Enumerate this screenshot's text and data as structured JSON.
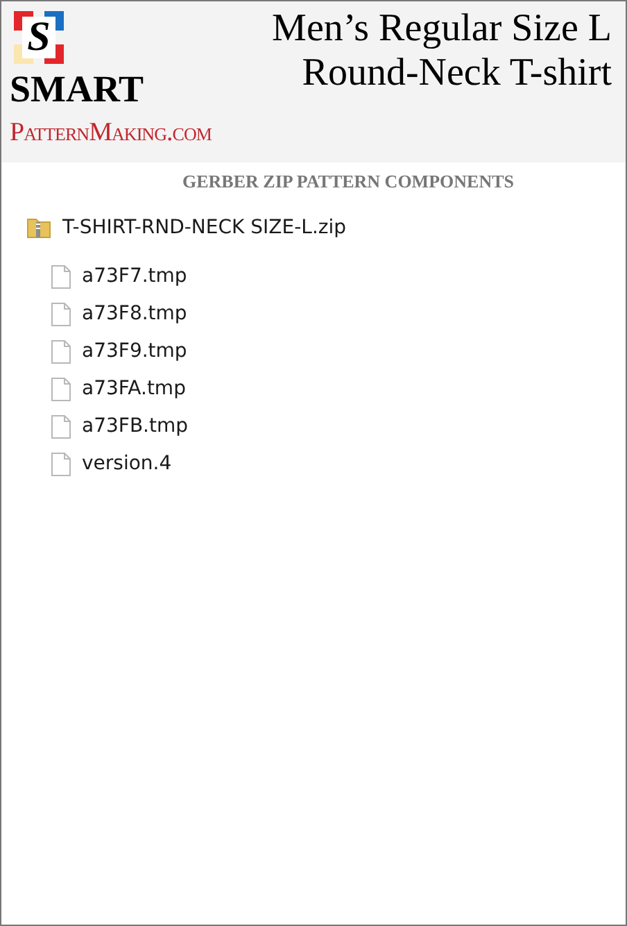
{
  "logo": {
    "mark": "S",
    "name": "SMART",
    "site": "PatternMaking.com"
  },
  "title": [
    "Men’s Regular Size L",
    "Round-Neck T-shirt"
  ],
  "section_heading": "GERBER ZIP PATTERN COMPONENTS",
  "tree": {
    "label": "T-SHIRT-RND-NECK SIZE-L.zip",
    "kind": "zip",
    "children": [
      {
        "label": "a73F7.tmp",
        "kind": "file"
      },
      {
        "label": "a73F8.tmp",
        "kind": "file"
      },
      {
        "label": "a73F9.tmp",
        "kind": "file"
      },
      {
        "label": "a73FA.tmp",
        "kind": "file"
      },
      {
        "label": "a73FB.tmp",
        "kind": "file"
      },
      {
        "label": "version.4",
        "kind": "file"
      }
    ]
  }
}
